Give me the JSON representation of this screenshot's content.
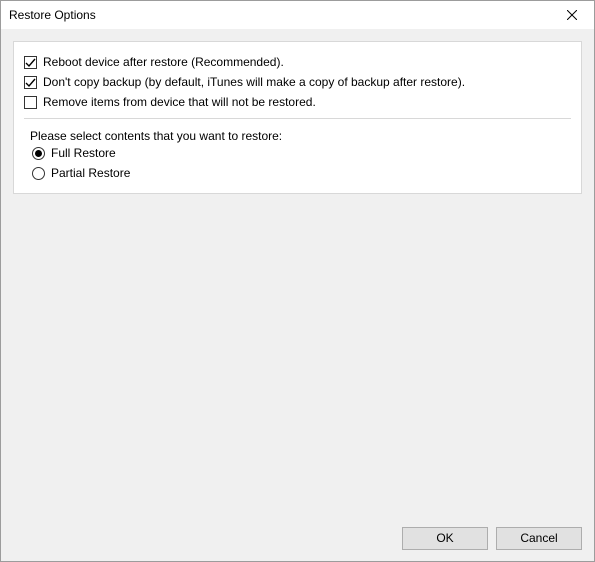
{
  "title": "Restore Options",
  "checkboxes": [
    {
      "label": "Reboot device after restore (Recommended).",
      "checked": true
    },
    {
      "label": "Don't copy backup (by default, iTunes will make a copy of backup after restore).",
      "checked": true
    },
    {
      "label": "Remove items from device that will not be restored.",
      "checked": false
    }
  ],
  "prompt": "Please select contents that you want to restore:",
  "radios": [
    {
      "label": "Full Restore",
      "selected": true
    },
    {
      "label": "Partial Restore",
      "selected": false
    }
  ],
  "buttons": {
    "ok": "OK",
    "cancel": "Cancel"
  }
}
